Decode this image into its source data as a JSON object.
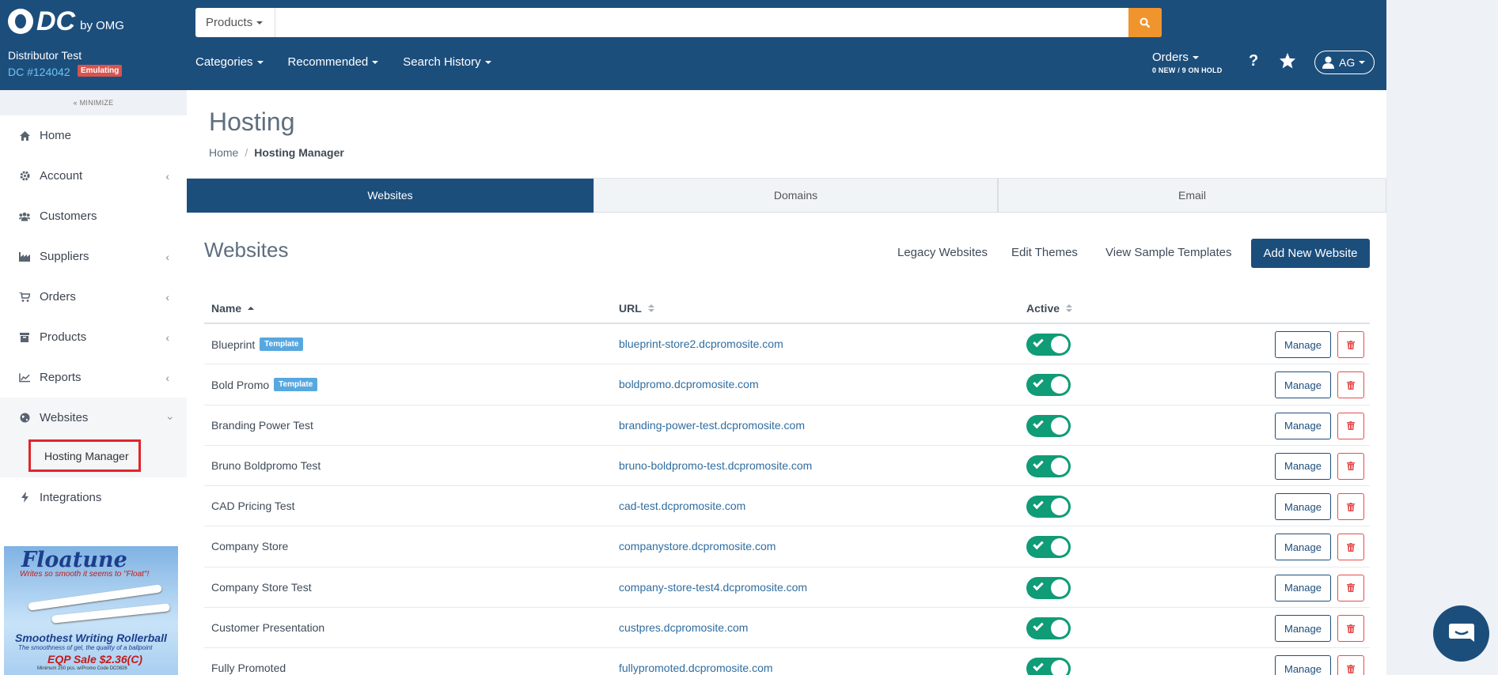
{
  "brand": {
    "logo_text": "DC",
    "logo_sub": "by OMG"
  },
  "account": {
    "name": "Distributor Test",
    "id": "DC #124042",
    "status_badge": "Emulating"
  },
  "search": {
    "scope": "Products",
    "value": "",
    "placeholder": ""
  },
  "topnav": {
    "categories": "Categories",
    "recommended": "Recommended",
    "history": "Search History"
  },
  "orders": {
    "label": "Orders",
    "summary": "0 NEW / 9 ON HOLD"
  },
  "user": {
    "initials": "AG"
  },
  "sidebar": {
    "minimize": "MINIMIZE",
    "items": [
      {
        "label": "Home",
        "icon": "home-icon"
      },
      {
        "label": "Account",
        "icon": "gear-icon"
      },
      {
        "label": "Customers",
        "icon": "users-icon"
      },
      {
        "label": "Suppliers",
        "icon": "industry-icon"
      },
      {
        "label": "Orders",
        "icon": "cart-icon"
      },
      {
        "label": "Products",
        "icon": "box-icon"
      },
      {
        "label": "Reports",
        "icon": "line-chart-icon"
      },
      {
        "label": "Websites",
        "icon": "globe-icon"
      },
      {
        "label": "Integrations",
        "icon": "bolt-icon"
      }
    ],
    "sub_item": "Hosting Manager"
  },
  "ad": {
    "title": "Floatune",
    "tagline": "Writes so smooth it seems to \"Float\"!",
    "headline": "Smoothest Writing Rollerball",
    "sub": "The smoothness of gel, the quality of a ballpoint",
    "sale": "EQP Sale $2.36(C)",
    "fine": "Minimum 250 pcs. w/Promo Code DC0826"
  },
  "page": {
    "title": "Hosting",
    "breadcrumb_home": "Home",
    "breadcrumb_current": "Hosting Manager"
  },
  "tabs": [
    "Websites",
    "Domains",
    "Email"
  ],
  "section": {
    "title": "Websites",
    "legacy": "Legacy Websites",
    "themes": "Edit Themes",
    "samples": "View Sample Templates",
    "add": "Add New Website"
  },
  "table": {
    "headers": {
      "name": "Name",
      "url": "URL",
      "active": "Active"
    },
    "manage_label": "Manage",
    "rows": [
      {
        "name": "Blueprint",
        "badge": "Template",
        "url": "blueprint-store2.dcpromosite.com",
        "active": true
      },
      {
        "name": "Bold Promo",
        "badge": "Template",
        "url": "boldpromo.dcpromosite.com",
        "active": true
      },
      {
        "name": "Branding Power Test",
        "badge": "",
        "url": "branding-power-test.dcpromosite.com",
        "active": true
      },
      {
        "name": "Bruno Boldpromo Test",
        "badge": "",
        "url": "bruno-boldpromo-test.dcpromosite.com",
        "active": true
      },
      {
        "name": "CAD Pricing Test",
        "badge": "",
        "url": "cad-test.dcpromosite.com",
        "active": true
      },
      {
        "name": "Company Store",
        "badge": "",
        "url": "companystore.dcpromosite.com",
        "active": true
      },
      {
        "name": "Company Store Test",
        "badge": "",
        "url": "company-store-test4.dcpromosite.com",
        "active": true
      },
      {
        "name": "Customer Presentation",
        "badge": "",
        "url": "custpres.dcpromosite.com",
        "active": true
      },
      {
        "name": "Fully Promoted",
        "badge": "",
        "url": "fullypromoted.dcpromosite.com",
        "active": true
      }
    ]
  },
  "colors": {
    "header": "#1c4e7c",
    "accent": "#f0952d",
    "toggle_on": "#0f9c76",
    "danger": "#e44d4d"
  }
}
